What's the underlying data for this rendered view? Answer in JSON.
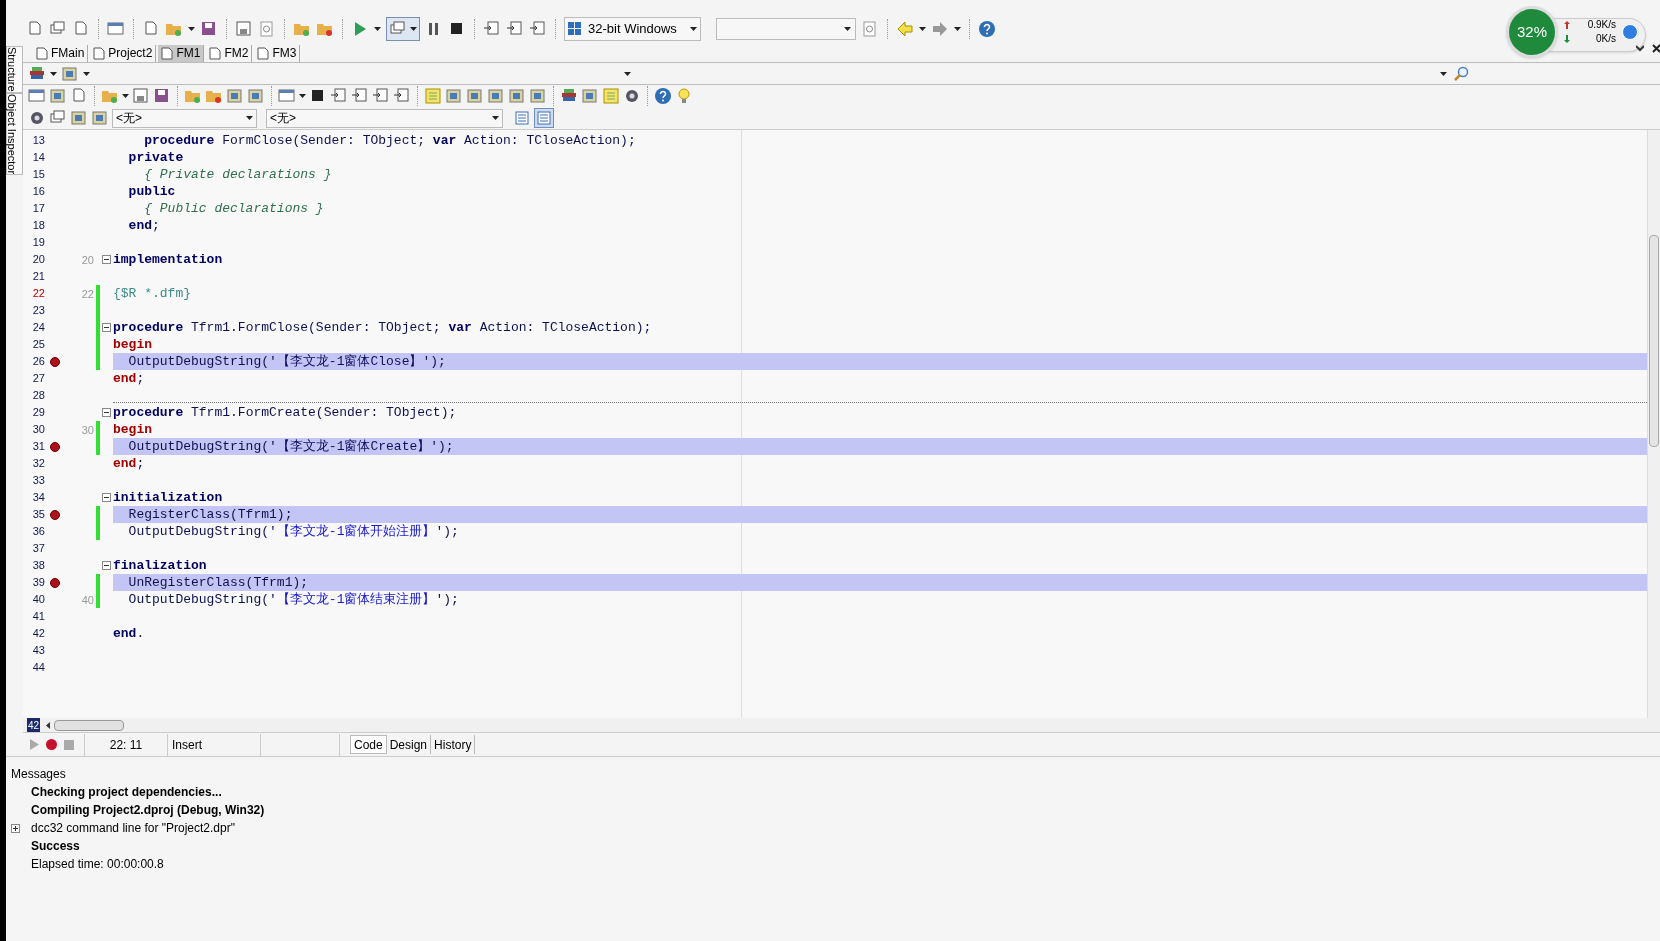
{
  "toolbar": {
    "platform": "32-bit Windows"
  },
  "net_monitor": {
    "cpu": "32%",
    "upload": "0.9K/s",
    "download": "0K/s"
  },
  "file_tabs": [
    {
      "label": "FMain",
      "selected": false
    },
    {
      "label": "Project2",
      "selected": false
    },
    {
      "label": "FM1",
      "selected": true
    },
    {
      "label": "FM2",
      "selected": false
    },
    {
      "label": "FM3",
      "selected": false
    }
  ],
  "side_tabs": [
    "Structure",
    "Object Inspector"
  ],
  "navigator": {
    "combos": [
      "<无>",
      "<无>"
    ],
    "toggles": [
      {
        "selected": false
      },
      {
        "selected": true
      }
    ]
  },
  "editor": {
    "lines": [
      {
        "number": "13",
        "breakpoint": false,
        "highlighted": false,
        "changed": false,
        "fold": false,
        "current": false,
        "separator": false,
        "tokens": [
          {
            "kind": "keyword",
            "text": "    procedure"
          },
          {
            "kind": "plain",
            "text": " FormClose(Sender: TObject; "
          },
          {
            "kind": "keyword",
            "text": "var"
          },
          {
            "kind": "plain",
            "text": " Action: TCloseAction);"
          }
        ]
      },
      {
        "number": "14",
        "breakpoint": false,
        "highlighted": false,
        "changed": false,
        "fold": false,
        "current": false,
        "separator": false,
        "tokens": [
          {
            "kind": "keyword",
            "text": "  private"
          }
        ]
      },
      {
        "number": "15",
        "breakpoint": false,
        "highlighted": false,
        "changed": false,
        "fold": false,
        "current": false,
        "separator": false,
        "tokens": [
          {
            "kind": "comment",
            "text": "    { Private declarations }"
          }
        ]
      },
      {
        "number": "16",
        "breakpoint": false,
        "highlighted": false,
        "changed": false,
        "fold": false,
        "current": false,
        "separator": false,
        "tokens": [
          {
            "kind": "keyword",
            "text": "  public"
          }
        ]
      },
      {
        "number": "17",
        "breakpoint": false,
        "highlighted": false,
        "changed": false,
        "fold": false,
        "current": false,
        "separator": false,
        "tokens": [
          {
            "kind": "comment",
            "text": "    { Public declarations }"
          }
        ]
      },
      {
        "number": "18",
        "breakpoint": false,
        "highlighted": false,
        "changed": false,
        "fold": false,
        "current": false,
        "separator": false,
        "tokens": [
          {
            "kind": "keyword",
            "text": "  end"
          },
          {
            "kind": "plain",
            "text": ";"
          }
        ]
      },
      {
        "number": "19",
        "breakpoint": false,
        "highlighted": false,
        "changed": false,
        "fold": false,
        "current": false,
        "separator": false
      },
      {
        "number": "20",
        "marker": "20",
        "breakpoint": false,
        "highlighted": false,
        "changed": false,
        "fold": true,
        "current": false,
        "separator": false,
        "tokens": [
          {
            "kind": "keyword",
            "text": "implementation"
          }
        ]
      },
      {
        "number": "21",
        "breakpoint": false,
        "highlighted": false,
        "changed": false,
        "fold": false,
        "current": false,
        "separator": false
      },
      {
        "number": "22",
        "marker": "22",
        "breakpoint": false,
        "highlighted": false,
        "changed": true,
        "fold": false,
        "current": true,
        "separator": false,
        "tokens": [
          {
            "kind": "directive",
            "text": "{$R *.dfm}"
          }
        ]
      },
      {
        "number": "23",
        "breakpoint": false,
        "highlighted": false,
        "changed": true,
        "fold": false,
        "current": false,
        "separator": false
      },
      {
        "number": "24",
        "breakpoint": false,
        "highlighted": false,
        "changed": true,
        "fold": true,
        "current": false,
        "separator": false,
        "tokens": [
          {
            "kind": "keyword",
            "text": "procedure"
          },
          {
            "kind": "plain",
            "text": " Tfrm1.FormClose(Sender: TObject; "
          },
          {
            "kind": "keyword",
            "text": "var"
          },
          {
            "kind": "plain",
            "text": " Action: TCloseAction);"
          }
        ]
      },
      {
        "number": "25",
        "breakpoint": false,
        "highlighted": false,
        "changed": true,
        "fold": false,
        "current": false,
        "separator": false,
        "tokens": [
          {
            "kind": "block",
            "text": "begin"
          }
        ]
      },
      {
        "number": "26",
        "breakpoint": true,
        "highlighted": true,
        "changed": true,
        "fold": false,
        "current": false,
        "separator": false,
        "tokens": [
          {
            "kind": "plain",
            "text": "  OutputDebugString('"
          },
          {
            "kind": "string",
            "text": "【李文龙-1窗体Close】"
          },
          {
            "kind": "plain",
            "text": "');"
          }
        ]
      },
      {
        "number": "27",
        "breakpoint": false,
        "highlighted": false,
        "changed": false,
        "fold": false,
        "current": false,
        "separator": false,
        "tokens": [
          {
            "kind": "block",
            "text": "end"
          },
          {
            "kind": "plain",
            "text": ";"
          }
        ]
      },
      {
        "number": "28",
        "breakpoint": false,
        "highlighted": false,
        "changed": false,
        "fold": false,
        "current": false,
        "separator": true
      },
      {
        "number": "29",
        "breakpoint": false,
        "highlighted": false,
        "changed": false,
        "fold": true,
        "current": false,
        "separator": false,
        "tokens": [
          {
            "kind": "keyword",
            "text": "procedure"
          },
          {
            "kind": "plain",
            "text": " Tfrm1.FormCreate(Sender: TObject);"
          }
        ]
      },
      {
        "number": "30",
        "marker": "30",
        "breakpoint": false,
        "highlighted": false,
        "changed": true,
        "fold": false,
        "current": false,
        "separator": false,
        "tokens": [
          {
            "kind": "block",
            "text": "begin"
          }
        ]
      },
      {
        "number": "31",
        "breakpoint": true,
        "highlighted": true,
        "changed": true,
        "fold": false,
        "current": false,
        "separator": false,
        "tokens": [
          {
            "kind": "plain",
            "text": "  OutputDebugString('"
          },
          {
            "kind": "string",
            "text": "【李文龙-1窗体Create】"
          },
          {
            "kind": "plain",
            "text": "');"
          }
        ]
      },
      {
        "number": "32",
        "breakpoint": false,
        "highlighted": false,
        "changed": false,
        "fold": false,
        "current": false,
        "separator": false,
        "tokens": [
          {
            "kind": "block",
            "text": "end"
          },
          {
            "kind": "plain",
            "text": ";"
          }
        ]
      },
      {
        "number": "33",
        "breakpoint": false,
        "highlighted": false,
        "changed": false,
        "fold": false,
        "current": false,
        "separator": false
      },
      {
        "number": "34",
        "breakpoint": false,
        "highlighted": false,
        "changed": false,
        "fold": true,
        "current": false,
        "separator": false,
        "tokens": [
          {
            "kind": "keyword",
            "text": "initialization"
          }
        ]
      },
      {
        "number": "35",
        "breakpoint": true,
        "highlighted": true,
        "changed": true,
        "fold": false,
        "current": false,
        "separator": false,
        "tokens": [
          {
            "kind": "plain",
            "text": "  RegisterClass(Tfrm1);"
          }
        ]
      },
      {
        "number": "36",
        "breakpoint": false,
        "highlighted": false,
        "changed": true,
        "fold": false,
        "current": false,
        "separator": false,
        "tokens": [
          {
            "kind": "plain",
            "text": "  OutputDebugString('"
          },
          {
            "kind": "string",
            "text": "【李文龙-1窗体开始注册】"
          },
          {
            "kind": "plain",
            "text": "');"
          }
        ]
      },
      {
        "number": "37",
        "breakpoint": false,
        "highlighted": false,
        "changed": false,
        "fold": false,
        "current": false,
        "separator": false
      },
      {
        "number": "38",
        "breakpoint": false,
        "highlighted": false,
        "changed": false,
        "fold": true,
        "current": false,
        "separator": false,
        "tokens": [
          {
            "kind": "keyword",
            "text": "finalization"
          }
        ]
      },
      {
        "number": "39",
        "breakpoint": true,
        "highlighted": true,
        "changed": true,
        "fold": false,
        "current": false,
        "separator": false,
        "tokens": [
          {
            "kind": "plain",
            "text": "  UnRegisterClass(Tfrm1);"
          }
        ]
      },
      {
        "number": "40",
        "marker": "40",
        "breakpoint": false,
        "highlighted": false,
        "changed": true,
        "fold": false,
        "current": false,
        "separator": false,
        "tokens": [
          {
            "kind": "plain",
            "text": "  OutputDebugString('"
          },
          {
            "kind": "string",
            "text": "【李文龙-1窗体结束注册】"
          },
          {
            "kind": "plain",
            "text": "');"
          }
        ]
      },
      {
        "number": "41",
        "breakpoint": false,
        "highlighted": false,
        "changed": false,
        "fold": false,
        "current": false,
        "separator": false
      },
      {
        "number": "42",
        "breakpoint": false,
        "highlighted": false,
        "changed": false,
        "fold": false,
        "current": false,
        "separator": false,
        "tokens": [
          {
            "kind": "keyword",
            "text": "end"
          },
          {
            "kind": "plain",
            "text": "."
          }
        ]
      },
      {
        "number": "43",
        "breakpoint": false,
        "highlighted": false,
        "changed": false,
        "fold": false,
        "current": false,
        "separator": false
      },
      {
        "number": "44",
        "breakpoint": false,
        "highlighted": false,
        "changed": false,
        "fold": false,
        "current": false,
        "separator": false
      }
    ]
  },
  "status": {
    "line_badge": "42",
    "position": "22: 11",
    "mode": "Insert",
    "view_tabs": [
      {
        "label": "Code",
        "selected": true
      },
      {
        "label": "Design",
        "selected": false
      },
      {
        "label": "History",
        "selected": false
      }
    ]
  },
  "messages": {
    "title": "Messages",
    "items": [
      {
        "text": "Checking project dependencies...",
        "bold": true,
        "expandable": false
      },
      {
        "text": "Compiling Project2.dproj (Debug, Win32)",
        "bold": true,
        "expandable": false
      },
      {
        "text": "dcc32 command line for \"Project2.dpr\"",
        "bold": false,
        "expandable": true
      },
      {
        "text": "Success",
        "bold": true,
        "expandable": false
      },
      {
        "text": "Elapsed time: 00:00:00.8",
        "bold": false,
        "expandable": false
      }
    ]
  }
}
